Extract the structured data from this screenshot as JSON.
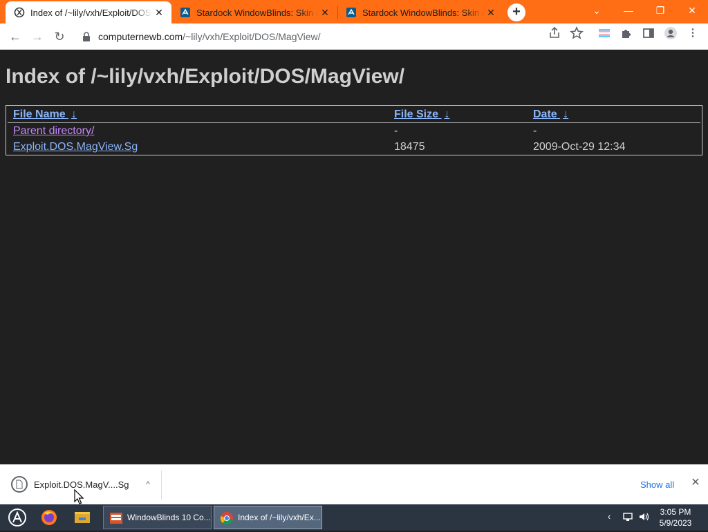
{
  "browser": {
    "tabs": [
      {
        "title": "Index of /~lily/vxh/Exploit/DOS/MagView/",
        "close": "✕"
      },
      {
        "title": "Stardock WindowBlinds: Skin a",
        "close": "✕"
      },
      {
        "title": "Stardock WindowBlinds: Skin a",
        "close": "✕"
      }
    ],
    "new_tab": "+",
    "window_controls": {
      "dropdown": "⌄",
      "minimize": "—",
      "restore": "❐",
      "close": "✕"
    },
    "toolbar": {
      "back": "←",
      "forward": "→",
      "reload": "↻",
      "url_host": "computernewb.com",
      "url_path": "/~lily/vxh/Exploit/DOS/MagView/"
    }
  },
  "page": {
    "title": "Index of /~lily/vxh/Exploit/DOS/MagView/",
    "columns": [
      {
        "label": "File Name",
        "sort": "↓"
      },
      {
        "label": "File Size",
        "sort": "↓"
      },
      {
        "label": "Date",
        "sort": "↓"
      }
    ],
    "rows": [
      {
        "name": "Parent directory/",
        "size": "-",
        "date": "-"
      },
      {
        "name": "Exploit.DOS.MagView.Sg",
        "size": "18475",
        "date": "2009-Oct-29 12:34"
      }
    ]
  },
  "download_shelf": {
    "file_name": "Exploit.DOS.MagV....Sg",
    "chevron": "^",
    "show_all": "Show all",
    "close": "✕"
  },
  "taskbar": {
    "windows": [
      {
        "label": "WindowBlinds 10 Co..."
      },
      {
        "label": "Index of /~lily/vxh/Ex..."
      }
    ],
    "tray_chevron": "‹",
    "time": "3:05 PM",
    "date": "5/9/2023"
  },
  "colors": {
    "tab_strip": "#ff6d14",
    "page_background": "#202020",
    "link": "#8ab4f8",
    "visited_link": "#c58af9",
    "taskbar": "#2b3542"
  }
}
